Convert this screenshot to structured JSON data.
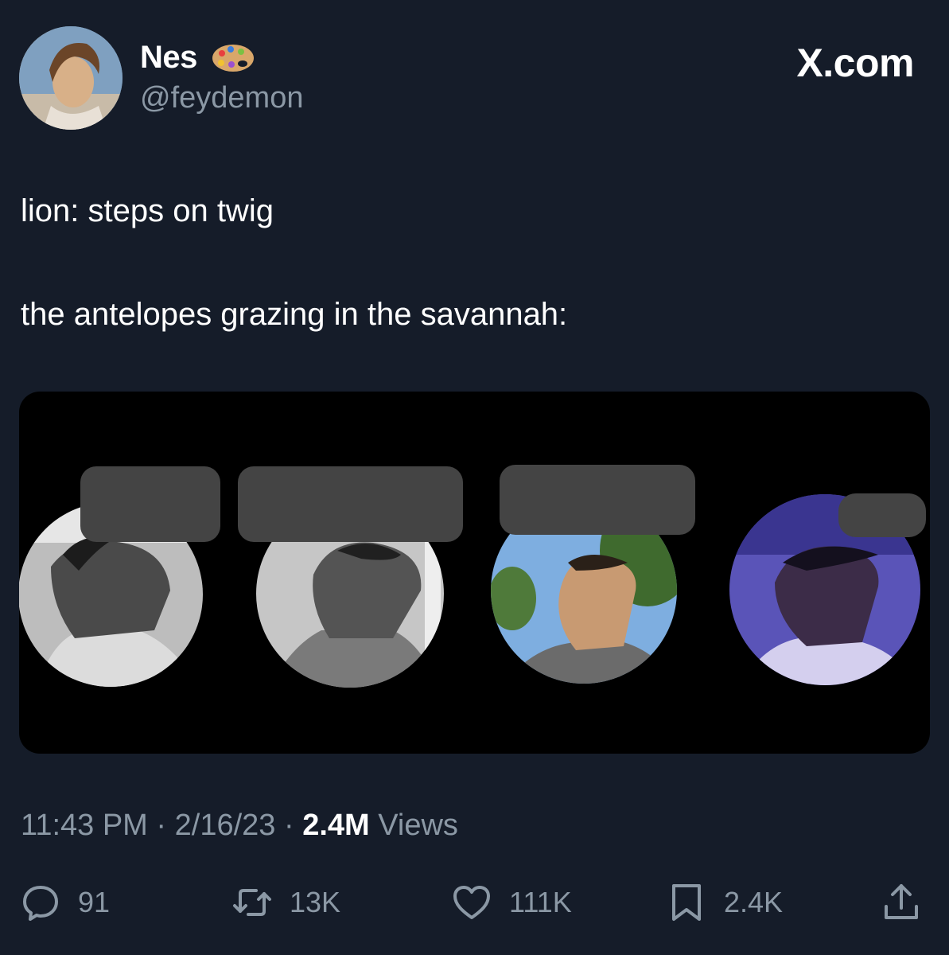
{
  "brand": "X.com",
  "author": {
    "display_name": "Nes",
    "handle": "@feydemon",
    "name_emoji": "artist-palette-icon"
  },
  "tweet": {
    "line1": "lion: steps on twig",
    "line2": "the antelopes grazing in the savannah:"
  },
  "meta": {
    "time": "11:43 PM",
    "separator1": " · ",
    "date": "2/16/23",
    "separator2": " · ",
    "views_count": "2.4M",
    "views_label": " Views"
  },
  "actions": {
    "replies": "91",
    "reposts": "13K",
    "likes": "111K",
    "bookmarks": "2.4K"
  },
  "colors": {
    "background": "#151c29",
    "secondary_text": "#8b98a5",
    "primary_text": "#ffffff"
  }
}
